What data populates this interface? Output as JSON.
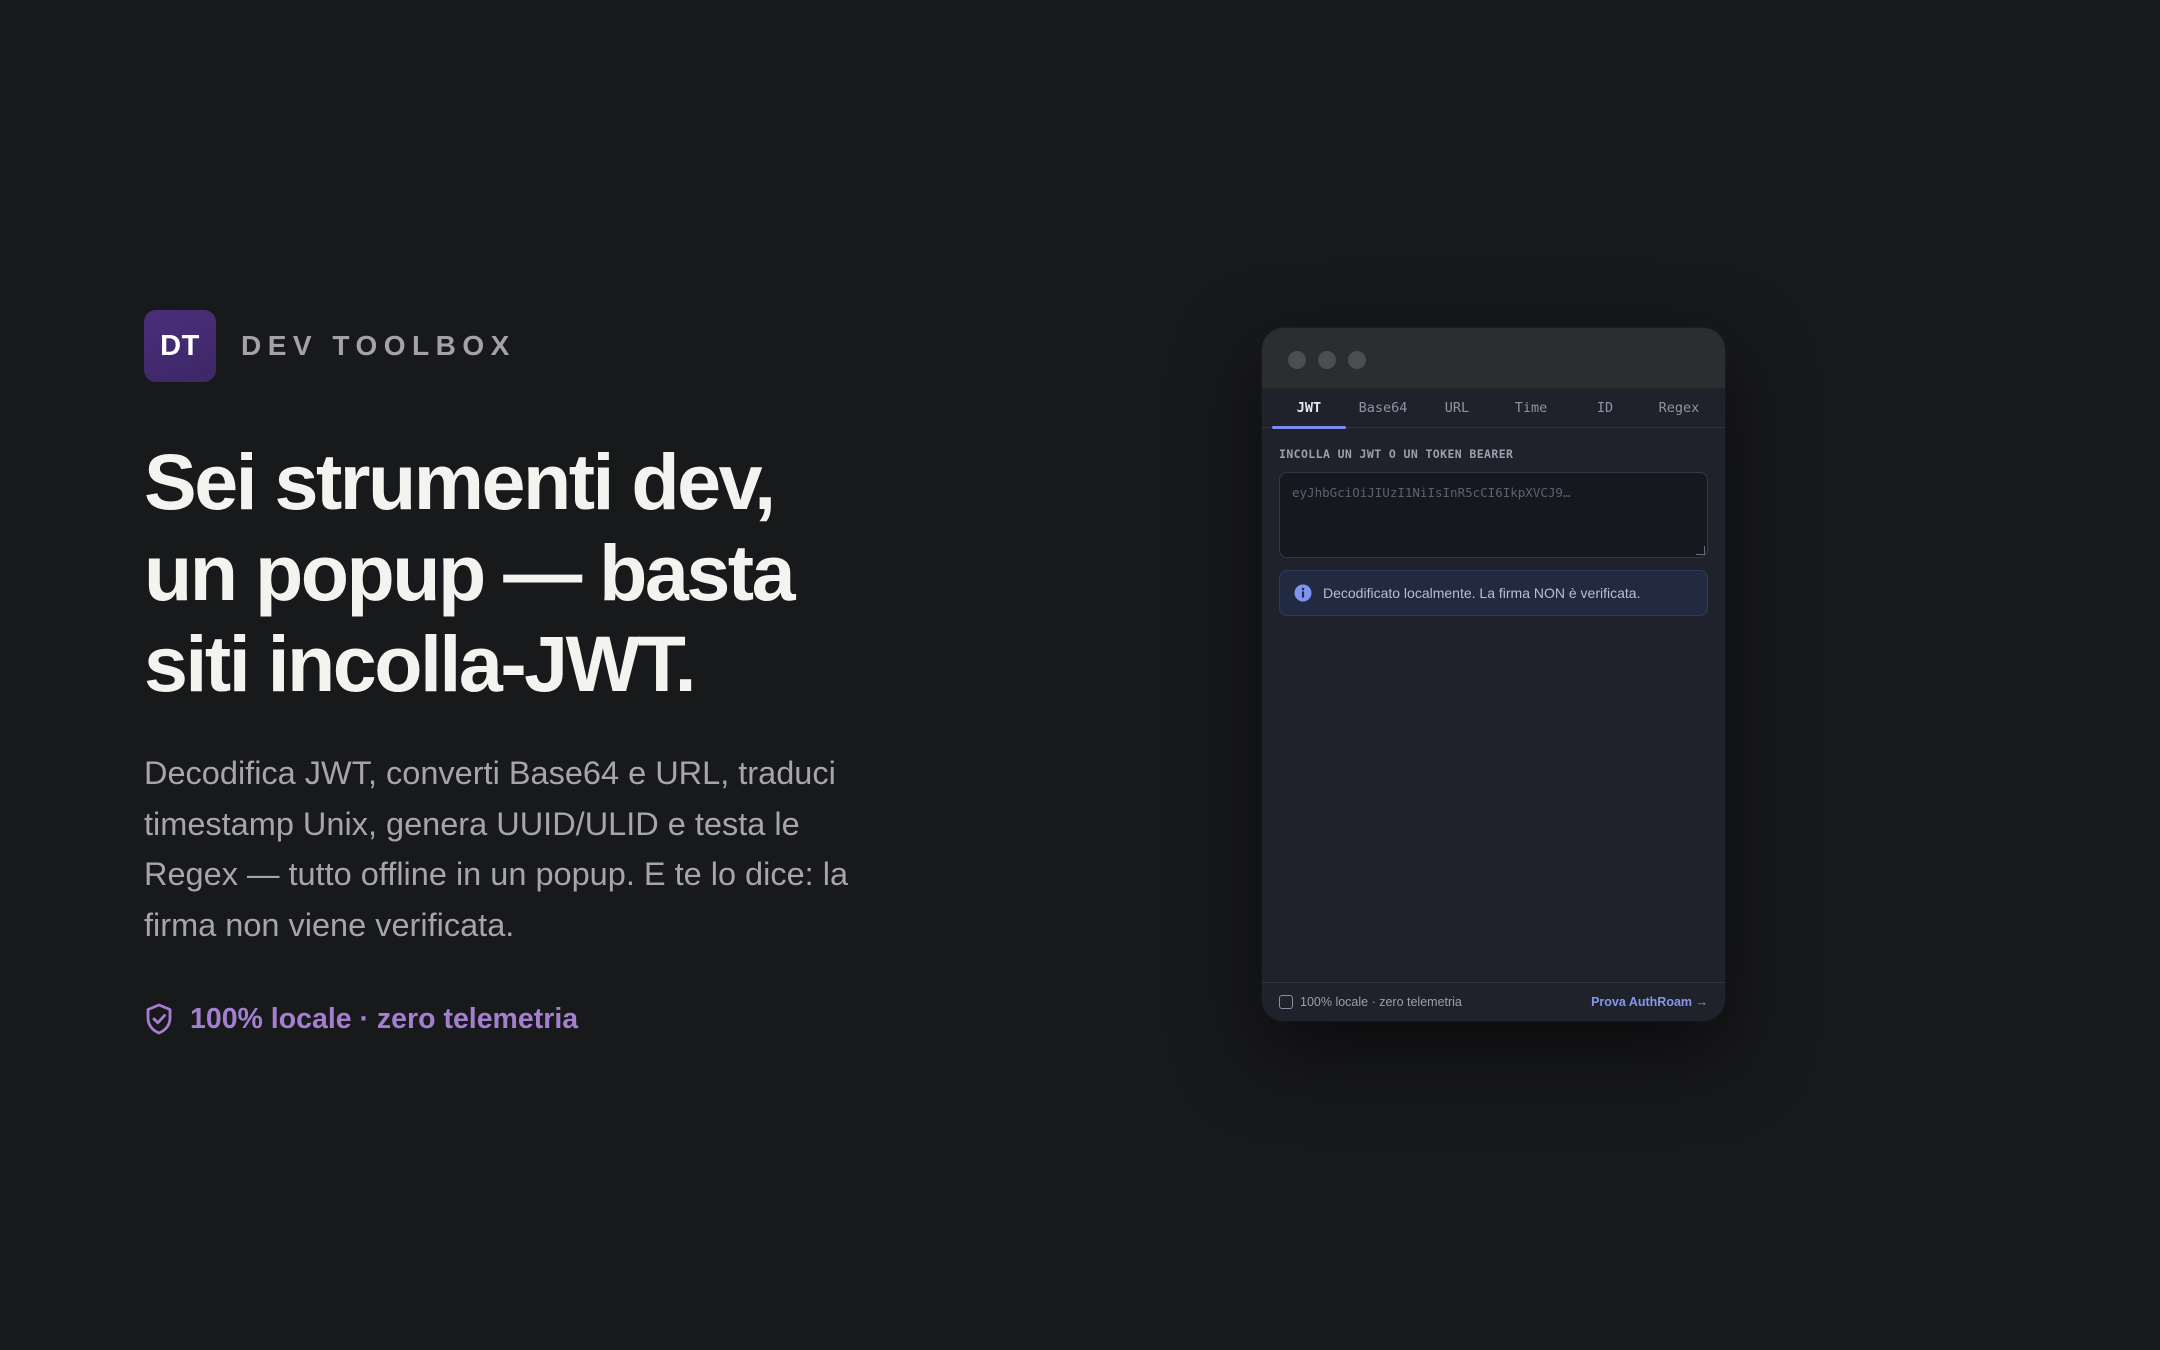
{
  "brand": {
    "logo_text": "DT",
    "name": "DEV TOOLBOX"
  },
  "hero": {
    "headline_lines": [
      "Sei strumenti dev,",
      "un popup — basta",
      "siti incolla-JWT."
    ],
    "lead": "Decodifica JWT, converti Base64 e URL, traduci timestamp Unix, genera UUID/ULID e testa le Regex — tutto offline in un popup. E te lo dice: la firma non viene verificata.",
    "badge": "100% locale · zero telemetria",
    "badge_icon": "shield-check-icon"
  },
  "popup": {
    "tabs": [
      {
        "label": "JWT",
        "active": true
      },
      {
        "label": "Base64",
        "active": false
      },
      {
        "label": "URL",
        "active": false
      },
      {
        "label": "Time",
        "active": false
      },
      {
        "label": "ID",
        "active": false
      },
      {
        "label": "Regex",
        "active": false
      }
    ],
    "field_label": "INCOLLA UN JWT O UN TOKEN BEARER",
    "input_placeholder": "eyJhbGciOiJIUzI1NiIsInR5cCI6IkpXVCJ9…",
    "notice": "Decodificato localmente. La firma NON è verificata.",
    "notice_icon": "info-icon",
    "footer_note": "100% locale · zero telemetria",
    "footer_link": "Prova AuthRoam →"
  },
  "colors": {
    "background": "#18191b",
    "logo": "#4a2f7a",
    "accent_purple": "#a47fd0",
    "accent_blue": "#7d8cf0"
  }
}
